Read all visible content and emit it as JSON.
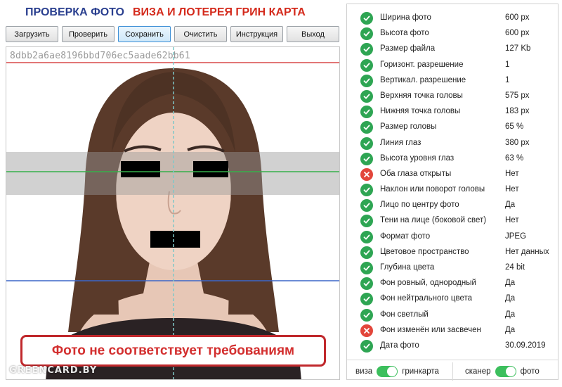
{
  "header": {
    "title_left": "ПРОВЕРКА ФОТО",
    "title_right": "ВИЗА И ЛОТЕРЕЯ ГРИН КАРТА"
  },
  "toolbar": {
    "load": "Загрузить",
    "check": "Проверить",
    "save": "Сохранить",
    "clear": "Очистить",
    "instructions": "Инструкция",
    "exit": "Выход",
    "active": "save"
  },
  "photo": {
    "hash": "8dbb2a6ae8196bbd706ec5aade62bb61",
    "verdict": "Фото не соответствует требованиям",
    "watermark": "GREENCARD.BY"
  },
  "checks": [
    {
      "label": "Ширина фото",
      "value": "600 px",
      "status": "ok"
    },
    {
      "label": "Высота фото",
      "value": "600 px",
      "status": "ok"
    },
    {
      "label": "Размер файла",
      "value": "127 Kb",
      "status": "ok"
    },
    {
      "label": "Горизонт. разрешение",
      "value": "1",
      "status": "ok"
    },
    {
      "label": "Вертикал. разрешение",
      "value": "1",
      "status": "ok"
    },
    {
      "label": "Верхняя точка головы",
      "value": "575 px",
      "status": "ok"
    },
    {
      "label": "Нижняя точка головы",
      "value": "183 px",
      "status": "ok"
    },
    {
      "label": "Размер головы",
      "value": "65 %",
      "status": "ok"
    },
    {
      "label": "Линия глаз",
      "value": "380 px",
      "status": "ok"
    },
    {
      "label": "Высота уровня глаз",
      "value": "63 %",
      "status": "ok"
    },
    {
      "label": "Оба глаза открыты",
      "value": "Нет",
      "status": "fail"
    },
    {
      "label": "Наклон или поворот головы",
      "value": "Нет",
      "status": "ok"
    },
    {
      "label": "Лицо по центру фото",
      "value": "Да",
      "status": "ok"
    },
    {
      "label": "Тени на лице (боковой свет)",
      "value": "Нет",
      "status": "ok"
    },
    {
      "label": "Формат фото",
      "value": "JPEG",
      "status": "ok"
    },
    {
      "label": "Цветовое пространство",
      "value": "Нет данных",
      "status": "ok"
    },
    {
      "label": "Глубина цвета",
      "value": "24 bit",
      "status": "ok"
    },
    {
      "label": "Фон ровный, однородный",
      "value": "Да",
      "status": "ok"
    },
    {
      "label": "Фон нейтрального цвета",
      "value": "Да",
      "status": "ok"
    },
    {
      "label": "Фон светлый",
      "value": "Да",
      "status": "ok"
    },
    {
      "label": "Фон изменён или засвечен",
      "value": "Да",
      "status": "fail"
    },
    {
      "label": "Дата фото",
      "value": "30.09.2019",
      "status": "ok"
    }
  ],
  "toggles": {
    "mode_left": "виза",
    "mode_right": "гринкарта",
    "mode_state": "on",
    "source_left": "сканер",
    "source_right": "фото",
    "source_state": "on"
  },
  "colors": {
    "ok": "#2ea553",
    "fail": "#e2463b",
    "accent": "#d42a1c",
    "title": "#2a3f8f"
  }
}
